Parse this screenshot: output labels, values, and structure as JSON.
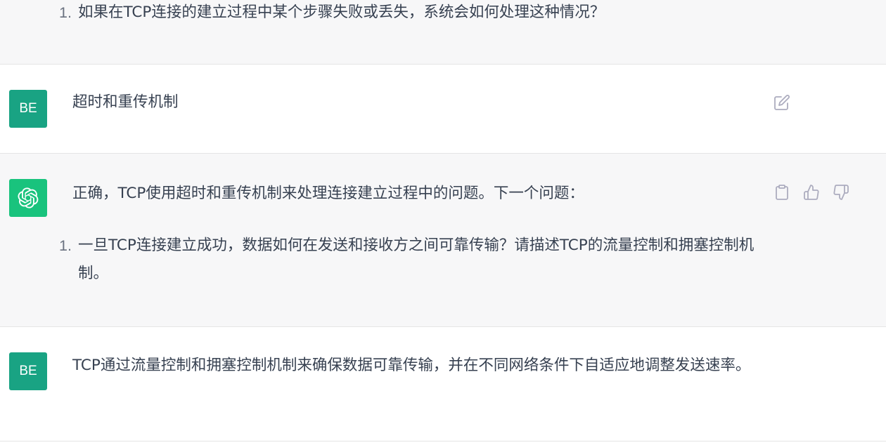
{
  "top_section": {
    "list_number": "1.",
    "list_text": "如果在TCP连接的建立过程中某个步骤失败或丢失，系统会如何处理这种情况？"
  },
  "user_message_1": {
    "avatar": "BE",
    "text": "超时和重传机制",
    "icons": [
      "edit-icon"
    ]
  },
  "assistant_message": {
    "avatar_icon": "openai-logo-icon",
    "text": "正确，TCP使用超时和重传机制来处理连接建立过程中的问题。下一个问题：",
    "list_number": "1.",
    "list_text": "一旦TCP连接建立成功，数据如何在发送和接收方之间可靠传输？请描述TCP的流量控制和拥塞控制机制。",
    "icons": [
      "clipboard-icon",
      "thumbs-up-icon",
      "thumbs-down-icon"
    ]
  },
  "user_message_2": {
    "avatar": "BE",
    "text": "TCP通过流量控制和拥塞控制机制来确保数据可靠传输，并在不同网络条件下自适应地调整发送速率。"
  },
  "colors": {
    "user_avatar": "#19a383",
    "assistant_avatar": "#19c37d",
    "assistant_bg": "#f7f7f8",
    "text": "#374151",
    "icon": "#acacbe"
  }
}
